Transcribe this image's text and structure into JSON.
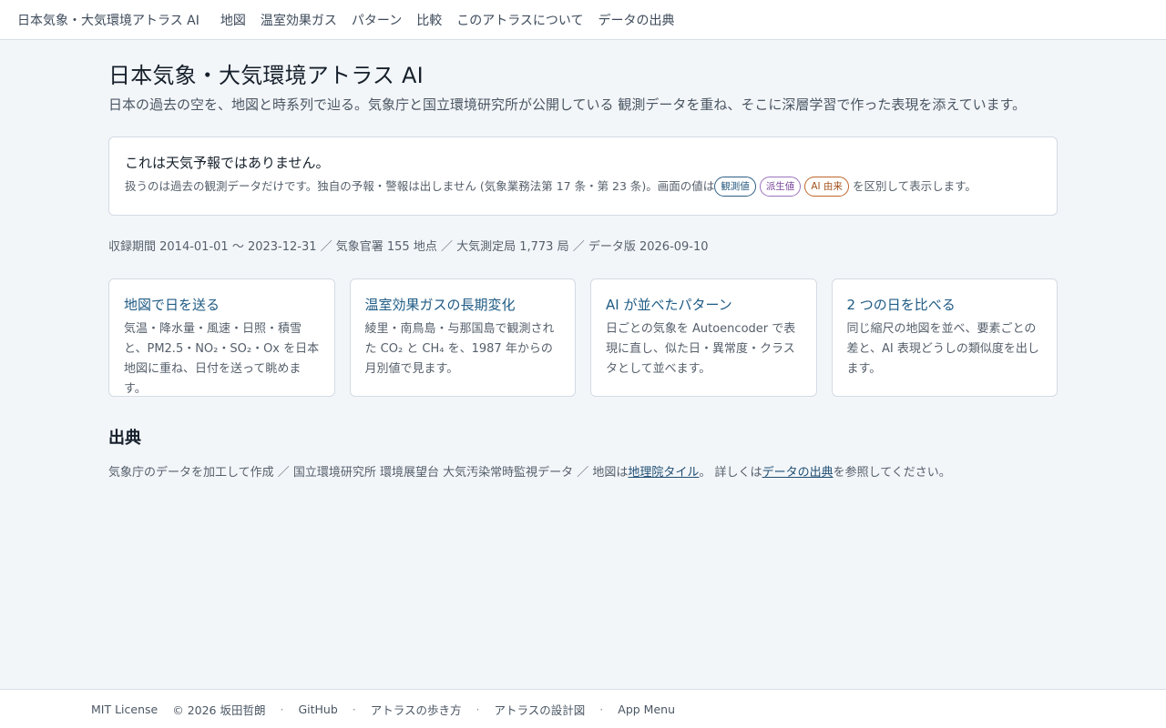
{
  "nav": {
    "brand": "日本気象・大気環境アトラス AI",
    "links": [
      "地図",
      "温室効果ガス",
      "パターン",
      "比較",
      "このアトラスについて",
      "データの出典"
    ]
  },
  "header": {
    "title": "日本気象・大気環境アトラス AI",
    "subtitle": "日本の過去の空を、地図と時系列で辿る。気象庁と国立環境研究所が公開している 観測データを重ね、そこに深層学習で作った表現を添えています。"
  },
  "notice": {
    "title": "これは天気予報ではありません。",
    "text_before": "扱うのは過去の観測データだけです。独自の予報・警報は出しません (気象業務法第 17 条・第 23 条)。画面の値は",
    "badges": [
      "観測値",
      "派生値",
      "AI 由来"
    ],
    "text_after": "を区別して表示します。"
  },
  "meta": "収録期間 2014-01-01 〜 2023-12-31 ／ 気象官署 155 地点 ／ 大気測定局 1,773 局 ／ データ版 2026-09-10",
  "cards": [
    {
      "title": "地図で日を送る",
      "desc": "気温・降水量・風速・日照・積雪と、PM2.5・NO₂・SO₂・Ox を日本地図に重ね、日付を送って眺めます。"
    },
    {
      "title": "温室効果ガスの長期変化",
      "desc": "綾里・南鳥島・与那国島で観測された CO₂ と CH₄ を、1987 年からの月別値で見ます。"
    },
    {
      "title": "AI が並べたパターン",
      "desc": "日ごとの気象を Autoencoder で表現に直し、似た日・異常度・クラスタとして並べます。"
    },
    {
      "title": "2 つの日を比べる",
      "desc": "同じ縮尺の地図を並べ、要素ごとの差と、AI 表現どうしの類似度を出します。"
    }
  ],
  "sources": {
    "title": "出典",
    "text1": "気象庁のデータを加工して作成 ／ 国立環境研究所 環境展望台 大気汚染常時監視データ ／ 地図は",
    "link1": "地理院タイル",
    "text2": "。 詳しくは",
    "link2": "データの出典",
    "text3": "を参照してください。"
  },
  "footer": {
    "license": "MIT License",
    "copyright": "© 2026 坂田哲朗",
    "links": [
      "GitHub",
      "アトラスの歩き方",
      "アトラスの設計図",
      "App Menu"
    ],
    "separator": "·"
  }
}
